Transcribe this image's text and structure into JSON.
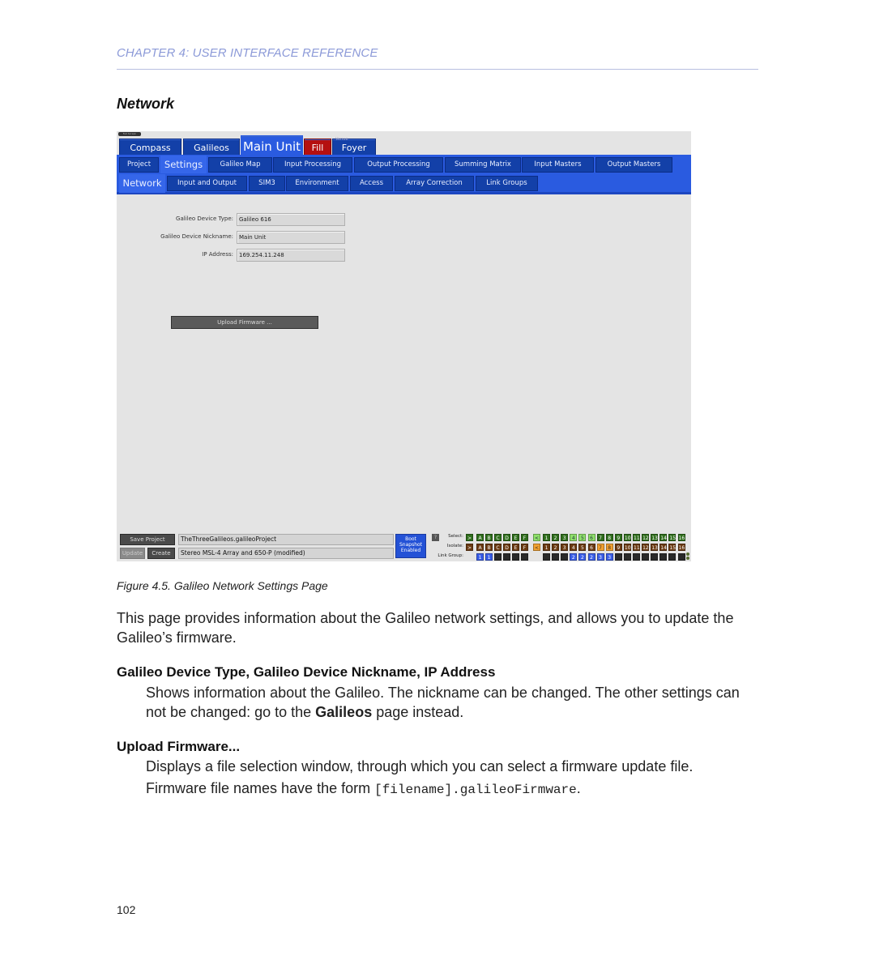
{
  "header": {
    "chapter": "CHAPTER 4: USER INTERFACE REFERENCE",
    "section_title": "Network"
  },
  "app": {
    "fullscreen_label": "Full Screen",
    "top_tabs": [
      {
        "label": "Compass",
        "state": "normal"
      },
      {
        "label": "Galileos",
        "state": "normal"
      },
      {
        "label": "Main Unit",
        "state": "active"
      },
      {
        "label": "Fill",
        "state": "alert"
      },
      {
        "label": "Foyer",
        "state": "normal",
        "superscript": "Venue"
      }
    ],
    "second_tabs": [
      {
        "label": "Project"
      },
      {
        "label": "Settings",
        "active": true
      },
      {
        "label": "Galileo Map"
      },
      {
        "label": "Input Processing"
      },
      {
        "label": "Output Processing"
      },
      {
        "label": "Summing Matrix"
      },
      {
        "label": "Input Masters"
      },
      {
        "label": "Output Masters"
      }
    ],
    "third_tabs": [
      {
        "label": "Network",
        "active": true
      },
      {
        "label": "Input and Output"
      },
      {
        "label": "SIM3"
      },
      {
        "label": "Environment"
      },
      {
        "label": "Access"
      },
      {
        "label": "Array Correction"
      },
      {
        "label": "Link Groups"
      }
    ],
    "fields": [
      {
        "label": "Galileo Device Type:",
        "value": "Galileo 616"
      },
      {
        "label": "Galileo Device Nickname:",
        "value": "Main Unit"
      },
      {
        "label": "IP Address:",
        "value": "169.254.11.248"
      }
    ],
    "upload_button": "Upload Firmware ...",
    "bottom": {
      "save_project": "Save Project",
      "project_file": "TheThreeGalileos.galileoProject",
      "update": "Update",
      "create": "Create",
      "snapshot_name": "Stereo MSL-4 Array and 650-P (modified)",
      "snapshot_status": [
        "Boot",
        "Snapshot",
        "Enabled"
      ],
      "help": "?",
      "select_label": "Select:",
      "isolate_label": "Isolate:",
      "link_group_label": "Link Group:",
      "arrow_right": ">",
      "arrow_left": "<",
      "outputs": [
        "A",
        "B",
        "C",
        "D",
        "E",
        "F"
      ],
      "inputs": [
        "1",
        "2",
        "3",
        "4",
        "5",
        "6",
        "7",
        "8",
        "9",
        "10",
        "11",
        "12",
        "13",
        "14",
        "15",
        "16"
      ],
      "select_highlight_inputs": [
        "4",
        "5",
        "6"
      ],
      "isolate_highlight_inputs": [
        "7",
        "8"
      ],
      "output_link_groups": [
        "1",
        "1",
        "",
        "",
        "",
        ""
      ],
      "input_link_groups": [
        "",
        "",
        "",
        "2",
        "2",
        "2",
        "3",
        "3",
        "",
        "",
        "",
        "",
        "",
        "",
        "",
        ""
      ]
    }
  },
  "caption": "Figure 4.5. Galileo Network Settings Page",
  "intro": "This page provides information about the Galileo network settings, and allows you to update the Galileo’s firmware.",
  "definitions": [
    {
      "term": "Galileo Device Type, Galileo Device Nickname, IP Address",
      "text_before": "Shows information about the Galileo. The nickname can be changed. The other settings can not be changed: go to the ",
      "bold": "Galileos",
      "text_after": " page instead."
    },
    {
      "term": "Upload Firmware...",
      "line1": "Displays a file selection window, through which you can select a firmware update file.",
      "line2_before": "Firmware file names have the form ",
      "code": "[filename].galileoFirmware",
      "line2_after": "."
    }
  ],
  "page_number": "102"
}
